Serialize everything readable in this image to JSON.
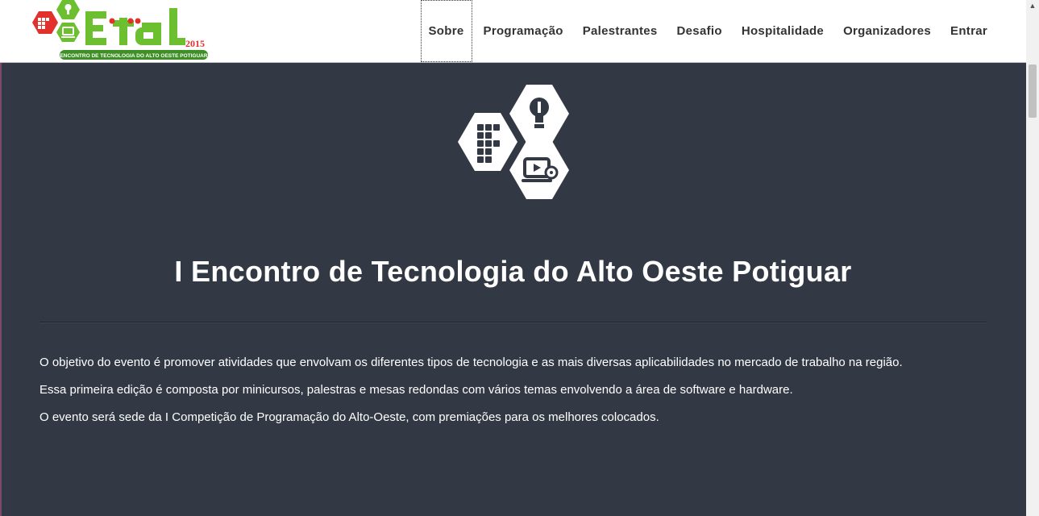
{
  "brand": {
    "logo_text": "ETAL",
    "logo_year": "2015",
    "logo_tagline": "ENCONTRO DE TECNOLOGIA DO ALTO OESTE POTIGUAR",
    "colors": {
      "red": "#e2312c",
      "green": "#6cbf2e",
      "dark_green": "#3e8f26"
    }
  },
  "navbar": {
    "items": [
      {
        "label": "Sobre",
        "active": true
      },
      {
        "label": "Programação"
      },
      {
        "label": "Palestrantes"
      },
      {
        "label": "Desafio"
      },
      {
        "label": "Hospitalidade"
      },
      {
        "label": "Organizadores"
      },
      {
        "label": "Entrar"
      }
    ]
  },
  "hero": {
    "icons": [
      "lightbulb-icon",
      "if-grid-icon",
      "laptop-play-icon"
    ],
    "title": "I Encontro de Tecnologia do Alto Oeste Potiguar"
  },
  "content": {
    "paragraphs": [
      "O objetivo do evento é promover atividades que envolvam os diferentes tipos de tecnologia e as mais diversas aplicabilidades no mercado de trabalho na região.",
      "Essa primeira edição é composta por minicursos, palestras e mesas redondas com vários temas envolvendo a área de software e hardware.",
      "O evento será sede da I Competição de Programação do Alto-Oeste, com premiações para os melhores colocados."
    ]
  },
  "theme": {
    "background": "#323844",
    "navbar_bg": "#ffffff",
    "text": "#ffffff"
  },
  "scrollbar": {
    "up_arrow": "▲"
  }
}
